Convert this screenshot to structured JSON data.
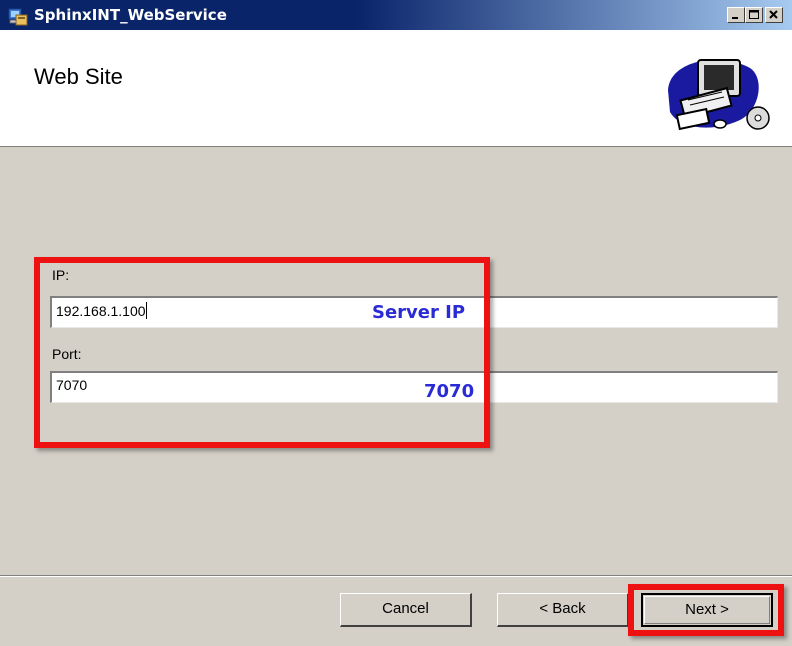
{
  "window": {
    "title": "SphinxINT_WebService",
    "app_icon": "installer-icon",
    "controls": [
      "minimize-icon",
      "maximize-icon",
      "close-icon"
    ]
  },
  "header": {
    "title": "Web Site",
    "graphic_icon": "computer-setup-icon"
  },
  "form": {
    "ip": {
      "label": "IP:",
      "value": "192.168.1.100"
    },
    "port": {
      "label": "Port:",
      "value": "7070"
    }
  },
  "annotations": {
    "ip_note": "Server IP",
    "port_note": "7070",
    "highlight_color": "#ee1111",
    "note_color": "#2b2bd6"
  },
  "footer": {
    "cancel_label": "Cancel",
    "back_label": "< Back",
    "next_label": "Next >"
  },
  "colors": {
    "titlebar_start": "#0a246a",
    "titlebar_end": "#a6caf0",
    "dialog_bg": "#d4d0c8",
    "header_bg": "#ffffff"
  }
}
